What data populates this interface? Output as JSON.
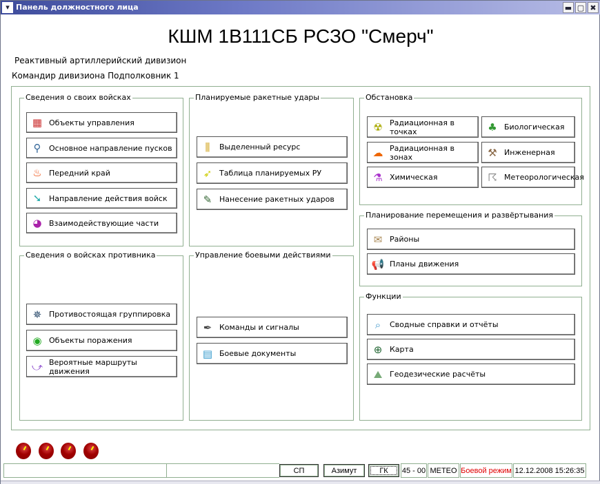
{
  "window": {
    "title": "Панель должностного лица",
    "menu_icon": "▾",
    "min": "▬",
    "max": "▢",
    "close": "✖"
  },
  "header": {
    "title": "КШМ 1В111СБ РСЗО \"Смерч\"",
    "unit": "Реактивный артиллерийский дивизион",
    "officer": "Командир дивизиона Подполковник 1"
  },
  "groups": {
    "own": {
      "label": "Сведения о своих войсках",
      "buttons": [
        "Объекты управления",
        "Основное направление пусков",
        "Передний край",
        "Направление действия войск",
        "Взаимодействующие части"
      ]
    },
    "enemy": {
      "label": "Сведения о войсках противника",
      "buttons": [
        "Противостоящая группировка",
        "Объекты поражения",
        "Вероятные маршруты движения"
      ]
    },
    "strikes": {
      "label": "Планируемые ракетные удары",
      "buttons": [
        "Выделенный ресурс",
        "Таблица планируемых РУ",
        "Нанесение ракетных ударов"
      ]
    },
    "combat": {
      "label": "Управление боевыми действиями",
      "buttons": [
        "Команды и сигналы",
        "Боевые документы"
      ]
    },
    "situation": {
      "label": "Обстановка",
      "buttons": [
        "Радиационная в точках",
        "Биологическая",
        "Радиационная в зонах",
        "Инженерная",
        "Химическая",
        "Метеорологическая"
      ]
    },
    "planning": {
      "label": "Планирование перемещения и развёртывания",
      "buttons": [
        "Районы",
        "Планы движения"
      ]
    },
    "functions": {
      "label": "Функции",
      "buttons": [
        "Сводные справки и отчёты",
        "Карта",
        "Геодезические расчёты"
      ]
    }
  },
  "statusbar": {
    "sp": "СП",
    "azimuth": "Азимут",
    "gk": "ГК",
    "angle": "45 - 00",
    "meteo": "METEO",
    "mode": "Боевой режим",
    "datetime": "12.12.2008 15:26:35",
    "mode_color": "#e00000"
  }
}
